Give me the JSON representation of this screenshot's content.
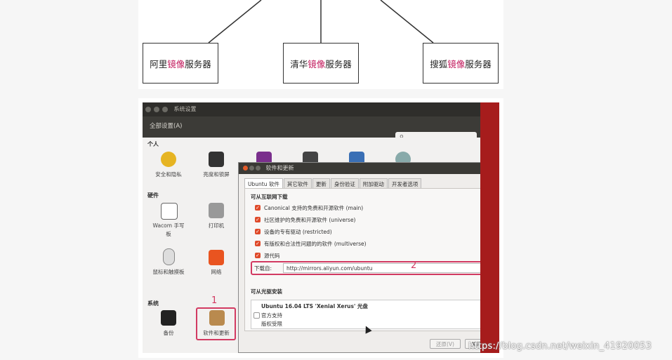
{
  "diagram": {
    "boxes": [
      {
        "pre": "阿里",
        "highlight": "镜像",
        "post": "服务器"
      },
      {
        "pre": "清华",
        "highlight": "镜像",
        "post": "服务器"
      },
      {
        "pre": "搜狐",
        "highlight": "镜像",
        "post": "服务器"
      }
    ],
    "highlight_color": "#c2185b"
  },
  "settings_window": {
    "title": "系统设置",
    "all_settings": "全部设置(A)",
    "search_icon": "search-icon",
    "sections": {
      "personal": "个人",
      "hardware": "硬件",
      "system": "系统"
    },
    "items": {
      "security_privacy": "安全和隐私",
      "brightness_lock": "亮度和锁屏",
      "wacom_line1": "Wacom 手写",
      "wacom_line2": "板",
      "printers": "打印机",
      "mouse_touchpad": "鼠标和触摸板",
      "network": "网络",
      "backup": "备份",
      "software_updates": "软件和更新"
    },
    "marker_1": "1"
  },
  "dialog": {
    "title": "软件和更新",
    "tabs": [
      "Ubuntu 软件",
      "其它软件",
      "更新",
      "身份验证",
      "附加驱动",
      "开发者选项"
    ],
    "internet_heading": "可从互联网下载",
    "options": [
      {
        "label": "Canonical 支持的免费和开源软件 (main)",
        "checked": true
      },
      {
        "label": "社区维护的免费和开源软件 (universe)",
        "checked": true
      },
      {
        "label": "设备的专有驱动 (restricted)",
        "checked": true
      },
      {
        "label": "有版权和合法性问题的的软件 (multiverse)",
        "checked": true
      },
      {
        "label": "源代码",
        "checked": true
      }
    ],
    "download_from_label": "下载自:",
    "download_from_value": "http://mirrors.aliyun.com/ubuntu",
    "marker_2": "2",
    "cdrom_heading": "可从光驱安装",
    "cdrom_title": "Ubuntu 16.04 LTS 'Xenial Xerus' 光盘",
    "cdrom_line1": "官方支持",
    "cdrom_line2": "版权受限",
    "revert_button": "还原(V)",
    "close_button": "关闭(C)"
  },
  "watermark": "https://blog.csdn.net/weixin_41920053",
  "accent_color": "#d23a62"
}
